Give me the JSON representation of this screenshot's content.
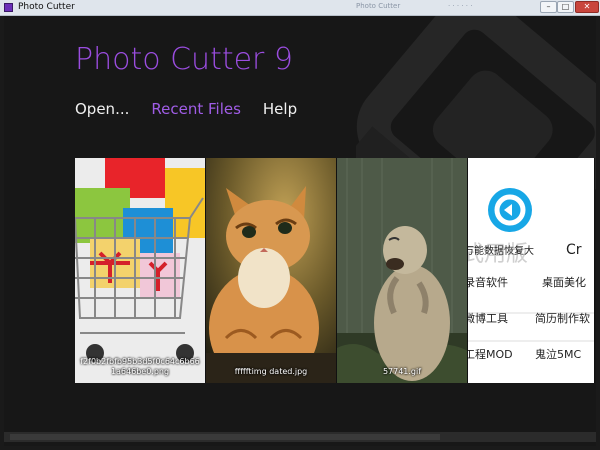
{
  "window": {
    "title": "Photo Cutter",
    "ghost_text_1": "Photo Cutter",
    "ghost_text_2": "· · · · · ·",
    "buttons": {
      "minimize": "–",
      "maximize": "□",
      "close": "✕"
    }
  },
  "app": {
    "title": "Photo Cutter 9"
  },
  "menu": {
    "items": [
      {
        "label": "Open..."
      },
      {
        "label": "Recent Files"
      },
      {
        "label": "Help"
      }
    ]
  },
  "recent_files": [
    {
      "line1": "f2f0b2fbfb95b3d5f0c64c6b66",
      "line2": "1a646be0.png",
      "icon": "shopping-cart-gifts"
    },
    {
      "line1": "ffffftimg dated.jpg",
      "line2": "",
      "icon": "kitten"
    },
    {
      "line1": "57741.gif",
      "line2": "",
      "icon": "marmot"
    },
    {
      "line1": "",
      "line2": "",
      "icon": "chinese-app-promo"
    }
  ],
  "promo_text": {
    "big1": "式用版",
    "r1a": "万能数据恢复大",
    "r1b": "Cr",
    "r2a": "录音软件",
    "r2b": "桌面美化",
    "r3a": "微博工具",
    "r3b": "简历制作软",
    "r4a": "工程MOD",
    "r4b": "鬼泣5MC"
  },
  "colors": {
    "accent": "#9b4de0",
    "menu_active": "#a05de6",
    "background": "#171717"
  }
}
